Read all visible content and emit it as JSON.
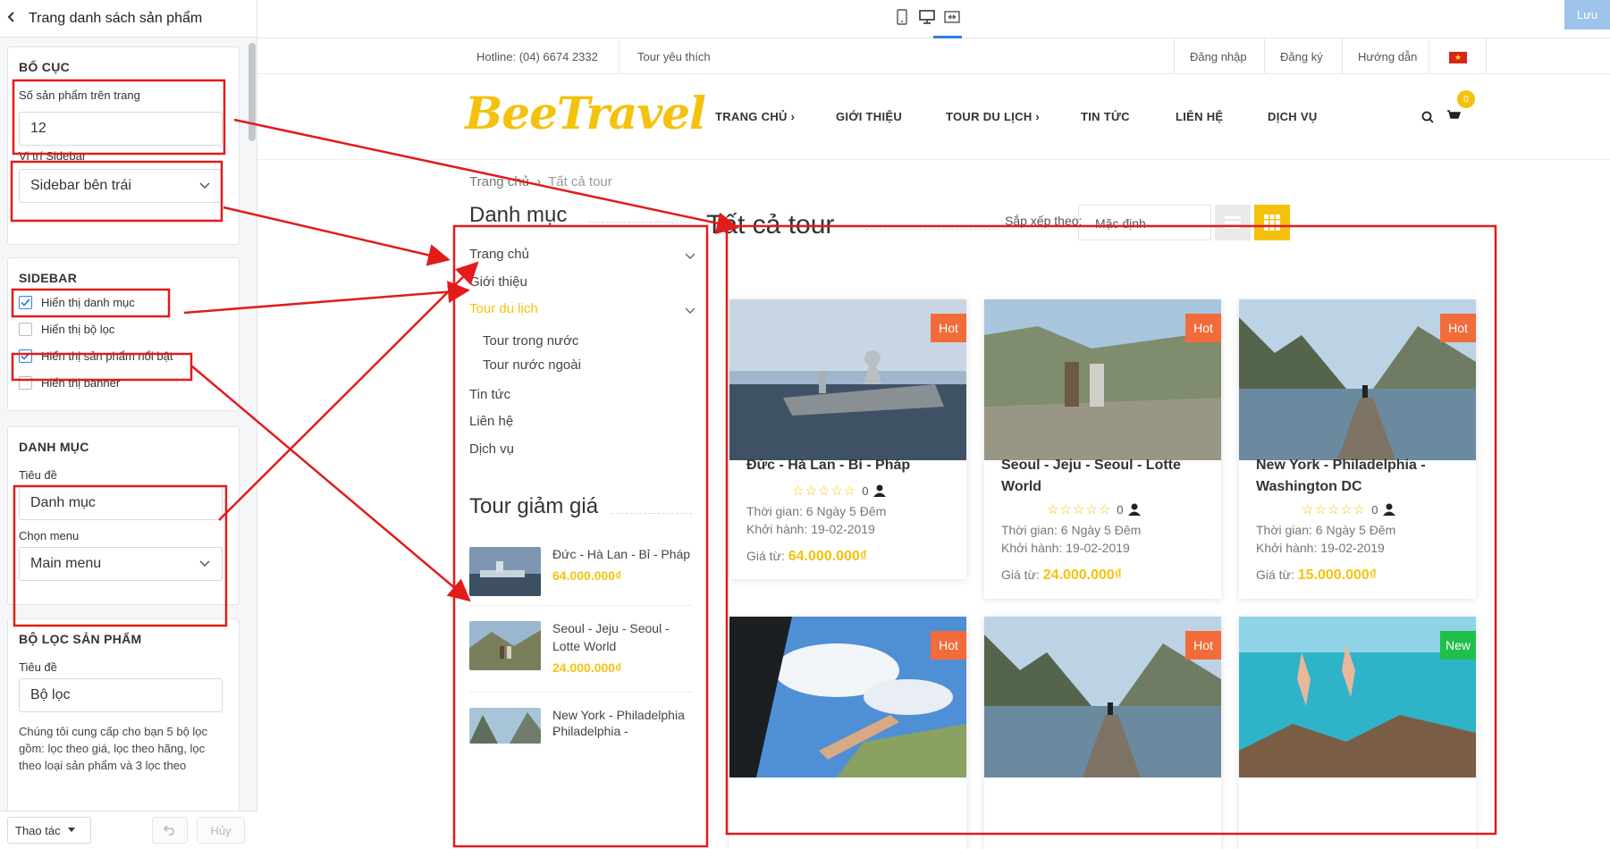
{
  "editor": {
    "title": "Trang danh sách sản phẩm",
    "save_label": "Lưu",
    "device_icons": [
      "mobile-icon",
      "desktop-icon",
      "fullscreen-icon"
    ]
  },
  "panel": {
    "layout": {
      "title": "BỐ CỤC",
      "per_page_label": "Số sản phẩm trên trang",
      "per_page_value": "12",
      "sidebar_pos_label": "Vị trí Sidebar",
      "sidebar_pos_value": "Sidebar bên trái"
    },
    "sidebar": {
      "title": "SIDEBAR",
      "options": [
        {
          "label": "Hiển thị danh mục",
          "checked": true
        },
        {
          "label": "Hiển thị bộ lọc",
          "checked": false
        },
        {
          "label": "Hiển thị sản phẩm nổi bật",
          "checked": true
        },
        {
          "label": "Hiển thị banner",
          "checked": false
        }
      ]
    },
    "category": {
      "title": "DANH MỤC",
      "heading_label": "Tiêu đề",
      "heading_value": "Danh mục",
      "menu_label": "Chọn menu",
      "menu_value": "Main menu"
    },
    "filter": {
      "title": "BỘ LỌC SẢN PHẨM",
      "heading_label": "Tiêu đề",
      "heading_value": "Bộ lọc",
      "help": "Chúng tôi cung cấp cho bạn 5 bộ lọc gồm: lọc theo giá, lọc theo hãng, lọc theo loại sản phẩm và 3 lọc theo"
    },
    "footer": {
      "action_label": "Thao tác",
      "cancel_label": "Hủy"
    }
  },
  "site": {
    "topbar": {
      "hotline": "Hotline: (04) 6674 2332",
      "favorite": "Tour yêu thích",
      "login": "Đăng nhập",
      "register": "Đăng ký",
      "guide": "Hướng dẫn"
    },
    "logo": "BeeTravel",
    "nav": [
      "TRANG CHỦ ›",
      "GIỚI THIỆU",
      "TOUR DU LỊCH ›",
      "TIN TỨC",
      "LIÊN HỆ",
      "DỊCH VỤ"
    ],
    "cart_count": "0",
    "breadcrumb": {
      "home": "Trang chủ",
      "sep": "›",
      "current": "Tất cả tour"
    },
    "sidebar": {
      "category_title": "Danh mục",
      "menu": [
        "Trang chủ",
        "Giới thiệu",
        "Tour du lịch",
        "Tour trong nước",
        "Tour nước ngoài",
        "Tin tức",
        "Liên hệ",
        "Dịch vụ"
      ],
      "promo_title": "Tour giảm giá",
      "promos": [
        {
          "name": "Đức - Hà Lan - Bỉ - Pháp",
          "price": "64.000.000₫"
        },
        {
          "name": "Seoul - Jeju - Seoul - Lotte World",
          "price": "24.000.000₫"
        },
        {
          "name": "New York - Philadelphia -",
          "price": ""
        }
      ]
    },
    "listing": {
      "title": "Tất cả tour",
      "sort_label": "Sắp xếp theo:",
      "sort_value": "Mặc định",
      "time_label": "Thời gian:",
      "depart_label": "Khởi hành:",
      "price_label": "Giá từ:",
      "cards": [
        {
          "title": "Đức - Hà Lan - Bỉ - Pháp",
          "badge": "Hot",
          "rating": "0",
          "time": "6 Ngày 5 Đêm",
          "depart": "19-02-2019",
          "price": "64.000.000₫"
        },
        {
          "title": "Seoul - Jeju - Seoul - Lotte World",
          "badge": "Hot",
          "rating": "0",
          "time": "6 Ngày 5 Đêm",
          "depart": "19-02-2019",
          "price": "24.000.000₫"
        },
        {
          "title": "New York - Philadelphia - Washington DC",
          "badge": "Hot",
          "rating": "0",
          "time": "6 Ngày 5 Đêm",
          "depart": "19-02-2019",
          "price": "15.000.000₫"
        },
        {
          "title": "",
          "badge": "Hot"
        },
        {
          "title": "",
          "badge": "Hot"
        },
        {
          "title": "",
          "badge": "New"
        }
      ]
    }
  },
  "colors": {
    "accent": "#f4c20d",
    "hot": "#f26b3a",
    "new": "#1fbf4a",
    "annotation": "#e31b1b",
    "primary": "#2f80ed"
  }
}
